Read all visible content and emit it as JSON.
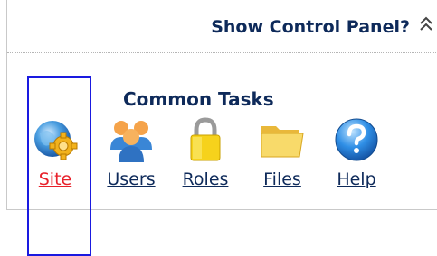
{
  "header": {
    "title": "Show Control Panel?"
  },
  "common_tasks": {
    "title": "Common Tasks",
    "items": [
      {
        "label": "Site",
        "icon": "globe-gear-icon",
        "state": "active"
      },
      {
        "label": "Users",
        "icon": "users-icon",
        "state": "normal"
      },
      {
        "label": "Roles",
        "icon": "padlock-icon",
        "state": "normal"
      },
      {
        "label": "Files",
        "icon": "folder-icon",
        "state": "normal"
      },
      {
        "label": "Help",
        "icon": "help-icon",
        "state": "normal"
      }
    ]
  },
  "colors": {
    "heading": "#0e2a5a",
    "active_link": "#e8202a",
    "selection_outline": "#1a1ae0"
  }
}
